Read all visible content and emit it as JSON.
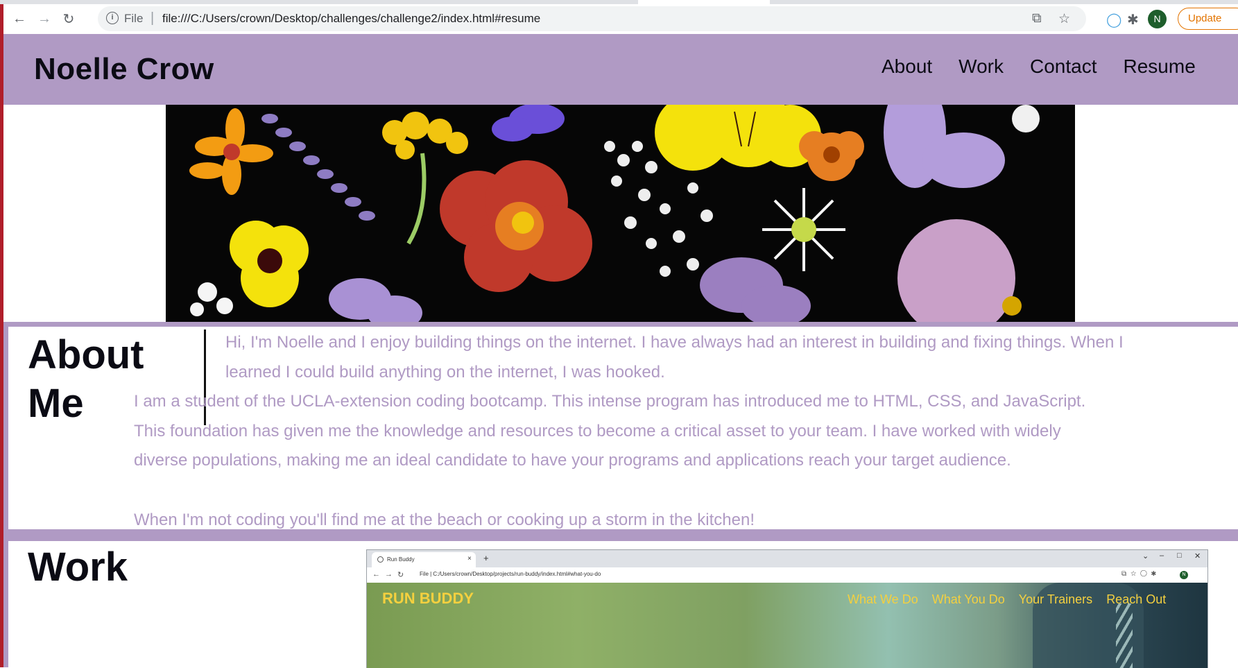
{
  "browser": {
    "scheme": "File",
    "url": "file:///C:/Users/crown/Desktop/challenges/challenge2/index.html#resume",
    "profile_initial": "N",
    "update_label": "Update",
    "icons": [
      "back-arrow-icon",
      "forward-arrow-icon",
      "reload-icon",
      "info-icon",
      "share-icon",
      "star-icon",
      "extension-icon",
      "puzzle-icon",
      "more-icon"
    ]
  },
  "header": {
    "title": "Noelle Crow",
    "nav": [
      "About",
      "Work",
      "Contact",
      "Resume"
    ]
  },
  "about": {
    "heading_line1": "About",
    "heading_line2": "Me",
    "paragraph1": "Hi, I'm Noelle and I enjoy building things on the internet. I have always had an interest in building and fixing things. When I learned I could build anything on the internet, I was hooked.",
    "paragraph2": "I am a student of the UCLA-extension coding bootcamp. This intense program has introduced me to HTML, CSS, and JavaScript. This foundation has given me the knowledge and resources to become a critical asset to your team. I have worked with widely diverse populations, making me an ideal candidate to have your programs and applications reach your target audience.",
    "paragraph3": "When I'm not coding you'll find me at the beach or cooking up a storm in the kitchen!"
  },
  "work": {
    "heading": "Work",
    "project_screenshot": {
      "tab_title": "Run Buddy",
      "tab_close": "×",
      "new_tab": "+",
      "scheme": "File",
      "url": "C:/Users/crown/Desktop/projects/run-buddy/index.html#what-you-do",
      "profile_initial": "N",
      "brand": "RUN BUDDY",
      "nav": [
        "What We Do",
        "What You Do",
        "Your Trainers",
        "Reach Out"
      ]
    }
  },
  "colors": {
    "accent_purple": "#b09ac4",
    "dark_text": "#0b0b14",
    "run_buddy_yellow": "#f4d03f",
    "update_orange": "#e37400"
  }
}
